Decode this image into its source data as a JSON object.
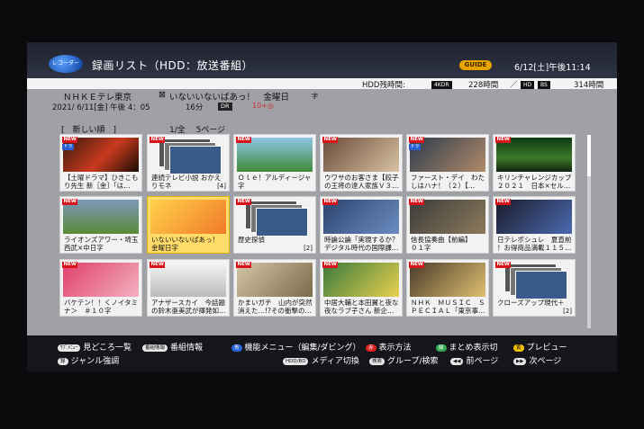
{
  "header": {
    "recorder_logo": "レコーダー",
    "title": "録画リスト（HDD：放送番組）",
    "guide_logo": "GUIDE",
    "clock": "6/12[土]午後11:14"
  },
  "hdd": {
    "label": "HDD残時間:",
    "badge_4k": "4KDR",
    "val_4k": "228時間",
    "slash": "／",
    "badge_hd": "HD",
    "badge_bs": "BS",
    "val_hd": "314時間"
  },
  "info": {
    "channel": "ＮＨＫＥテレ東京",
    "program_icon": "⊠",
    "program": "いないいないばあっ！　金曜日",
    "program_suffix": "字",
    "date": "2021/ 6/11[金] 午後 4：05",
    "duration": "16分",
    "mode": "DR",
    "extra": "10+◎"
  },
  "list": {
    "sort": "[　新しい順　]",
    "page": "1/全　 5ページ"
  },
  "tiles": [
    {
      "new": "NEW",
      "dora": "ドラ",
      "line1": "【土曜ドラマ】ひきこも",
      "line2": "り先生 新［金］「は…"
    },
    {
      "new": "NEW",
      "line1": "連続テレビ小説 おかえ",
      "line2": "りモネ",
      "count": "[4]"
    },
    {
      "new": "NEW",
      "line1": "Ｏｌｅ！アルディージャ",
      "line2": "字"
    },
    {
      "new": "NEW",
      "line1": "ウワサのお客さま【餃子",
      "line2": "の王将の達人家族Ｖ３…"
    },
    {
      "new": "NEW",
      "dora": "ドラ",
      "line1": "ファースト・デイ　わた",
      "line2": "しはハナ！（２）【…"
    },
    {
      "new": "NEW",
      "line1": "キリンチャレンジカップ",
      "line2": "２０２１　日本×セル…"
    },
    {
      "new": "NEW",
      "line1": "ライオンズアワー・埼玉",
      "line2": "西武×中日字"
    },
    {
      "new": "",
      "line1": "いないいないばあっ！",
      "line2": "金曜日字"
    },
    {
      "new": "NEW",
      "line1": "歴史探偵",
      "line2": "",
      "count": "[2]"
    },
    {
      "new": "NEW",
      "line1": "時論公論「実現するか？",
      "line2": "デジタル時代の国際課…"
    },
    {
      "new": "NEW",
      "line1": "信長協奏曲【前編】",
      "line2": "０１字"
    },
    {
      "new": "NEW",
      "line1": "日テレポシュレ　夏直前",
      "line2": "！お得商品満載１１５…"
    },
    {
      "new": "NEW",
      "line1": "バケテン！！くノイタミ",
      "line2": "ナ＞　＃１０字"
    },
    {
      "new": "NEW",
      "line1": "アナザースカイ　今話題",
      "line2": "の鈴木亜美武が揮発如…"
    },
    {
      "new": "NEW",
      "line1": "かまいガチ　山内が突然",
      "line2": "消えた…!?その衝撃の…"
    },
    {
      "new": "NEW",
      "line1": "中居大輔と本田翼と夜な",
      "line2": "夜なラブ子さん 新企…"
    },
    {
      "new": "NEW",
      "line1": "ＮＨＫ　ＭＵＳＩＣ　Ｓ",
      "line2": "ＰＥＣＩＡＬ「東京事…"
    },
    {
      "new": "NEW",
      "line1": "クローズアップ現代＋",
      "line2": "",
      "count": "[2]"
    }
  ],
  "footer": {
    "k1": "ｻﾌﾞﾒﾆｭｰ",
    "h1": "見どころ一覧",
    "k2": "番組情報",
    "h2": "番組情報",
    "k3": "青",
    "h3": "機能メニュー（編集/ダビング）",
    "k4": "赤",
    "h4": "表示方法",
    "k5": "緑",
    "h5": "まとめ表示切",
    "k6": "黄",
    "h6": "プレビュー",
    "k7": "録",
    "h7": "ジャンル強調",
    "k8": "HDD/BD",
    "h8": "メディア切換",
    "k9": "検索",
    "h9": "グループ/検索",
    "k10": "◀◀",
    "h10": "前ページ",
    "k11": "▶▶",
    "h11": "次ページ"
  }
}
